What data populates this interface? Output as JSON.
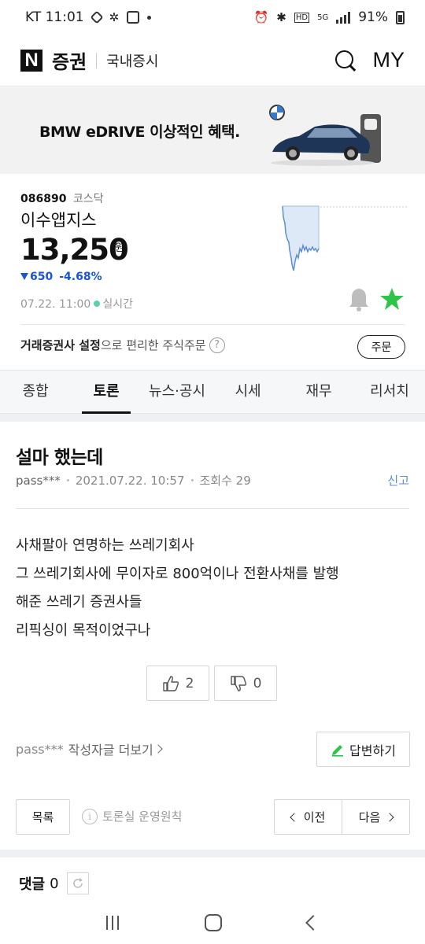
{
  "status_bar": {
    "carrier_time": "KT 11:01",
    "hd": "HD",
    "net": "5G",
    "battery": "91%"
  },
  "header": {
    "logo_letter": "N",
    "logo_text": "증권",
    "section": "국내증시",
    "my": "MY"
  },
  "ad": {
    "text": "BMW eDRIVE 이상적인 혜택."
  },
  "stock": {
    "code": "086890",
    "market": "코스닥",
    "name": "이수앱지스",
    "price": "13,250",
    "currency": "원",
    "change": "650",
    "change_pct": "-4.68%",
    "time": "07.22. 11:00",
    "live": "실시간",
    "order_bold": "거래증권사 설정",
    "order_rest": "으로 편리한 주식주문",
    "order_button": "주문",
    "down_color": "#1a55d6",
    "favorite_color": "#2ec44a"
  },
  "tabs": [
    {
      "label": "종합"
    },
    {
      "label": "토론",
      "active": true
    },
    {
      "label": "뉴스·공시"
    },
    {
      "label": "시세"
    },
    {
      "label": "재무"
    },
    {
      "label": "리서치"
    }
  ],
  "post": {
    "title": "설마 했는데",
    "author": "pass***",
    "date": "2021.07.22. 10:57",
    "views": "조회수 29",
    "report": "신고",
    "lines": [
      "사채팔아 연명하는 쓰레기회사",
      "그 쓰레기회사에 무이자로 800억이나 전환사채를 발행",
      "해준 쓰레기 증권사들",
      "리픽싱이 목적이었구나"
    ],
    "likes": "2",
    "dislikes": "0"
  },
  "actions": {
    "more_author": "pass***",
    "more_label": "작성자글 더보기",
    "reply": "답변하기",
    "list": "목록",
    "rules": "토론실 운영원칙",
    "prev": "이전",
    "next": "다음"
  },
  "comments": {
    "label": "댓글",
    "count": "0"
  }
}
